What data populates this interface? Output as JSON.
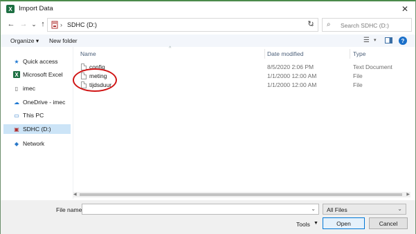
{
  "window": {
    "title": "Import Data",
    "app_icon": "excel-icon",
    "app_icon_letter": "X",
    "close_glyph": "✕"
  },
  "navigation": {
    "back_icon": "back-arrow-icon",
    "forward_icon": "forward-arrow-icon",
    "recent_icon": "chevron-down-icon",
    "up_icon": "up-arrow-icon",
    "back_glyph": "←",
    "forward_glyph": "→",
    "recent_glyph": "⌄",
    "up_glyph": "↑",
    "address": {
      "location": "SDHC (D:)",
      "separator": "›",
      "dropdown_glyph": "⌄"
    },
    "refresh_glyph": "↻",
    "search": {
      "placeholder": "Search SDHC (D:)",
      "icon_glyph": "⌕"
    }
  },
  "toolbar": {
    "organize_label": "Organize ▾",
    "new_folder_label": "New folder",
    "view_glyph": "☰",
    "view_arrow": "▾",
    "help_glyph": "?"
  },
  "sidebar": {
    "items": [
      {
        "label": "Quick access",
        "icon": "star-icon",
        "glyph": "★",
        "color": "#1e78d2"
      },
      {
        "label": "Microsoft Excel",
        "icon": "excel-icon",
        "glyph": "X",
        "color": "#1d6f42"
      },
      {
        "label": "imec",
        "icon": "document-icon",
        "glyph": "▯",
        "color": "#555555"
      },
      {
        "label": "OneDrive - imec",
        "icon": "cloud-icon",
        "glyph": "☁",
        "color": "#1e78d2"
      },
      {
        "label": "This PC",
        "icon": "computer-icon",
        "glyph": "▭",
        "color": "#2a78c8"
      },
      {
        "label": "SDHC (D:)",
        "icon": "sd-card-icon",
        "glyph": "▣",
        "color": "#b03030"
      },
      {
        "label": "Network",
        "icon": "network-icon",
        "glyph": "◆",
        "color": "#2a78c8"
      }
    ],
    "selected_index": 5
  },
  "file_list": {
    "columns": {
      "name": "Name",
      "date": "Date modified",
      "type": "Type"
    },
    "sort_glyph": "^",
    "rows": [
      {
        "name": "config",
        "date": "8/5/2020 2:06 PM",
        "type": "Text Document"
      },
      {
        "name": "meting",
        "date": "1/1/2000 12:00 AM",
        "type": "File"
      },
      {
        "name": "tijdsduur",
        "date": "1/1/2000 12:00 AM",
        "type": "File"
      }
    ],
    "annotation_color": "#d01414"
  },
  "scrollbar": {
    "left_glyph": "◀",
    "right_glyph": "▶"
  },
  "footer": {
    "file_name_label": "File name:",
    "file_name_value": "",
    "file_name_dropdown_glyph": "⌄",
    "filter_value": "All Files",
    "filter_dropdown_glyph": "⌄",
    "tools_label": "Tools",
    "tools_arrow": "▼",
    "open_label": "Open",
    "cancel_label": "Cancel"
  }
}
